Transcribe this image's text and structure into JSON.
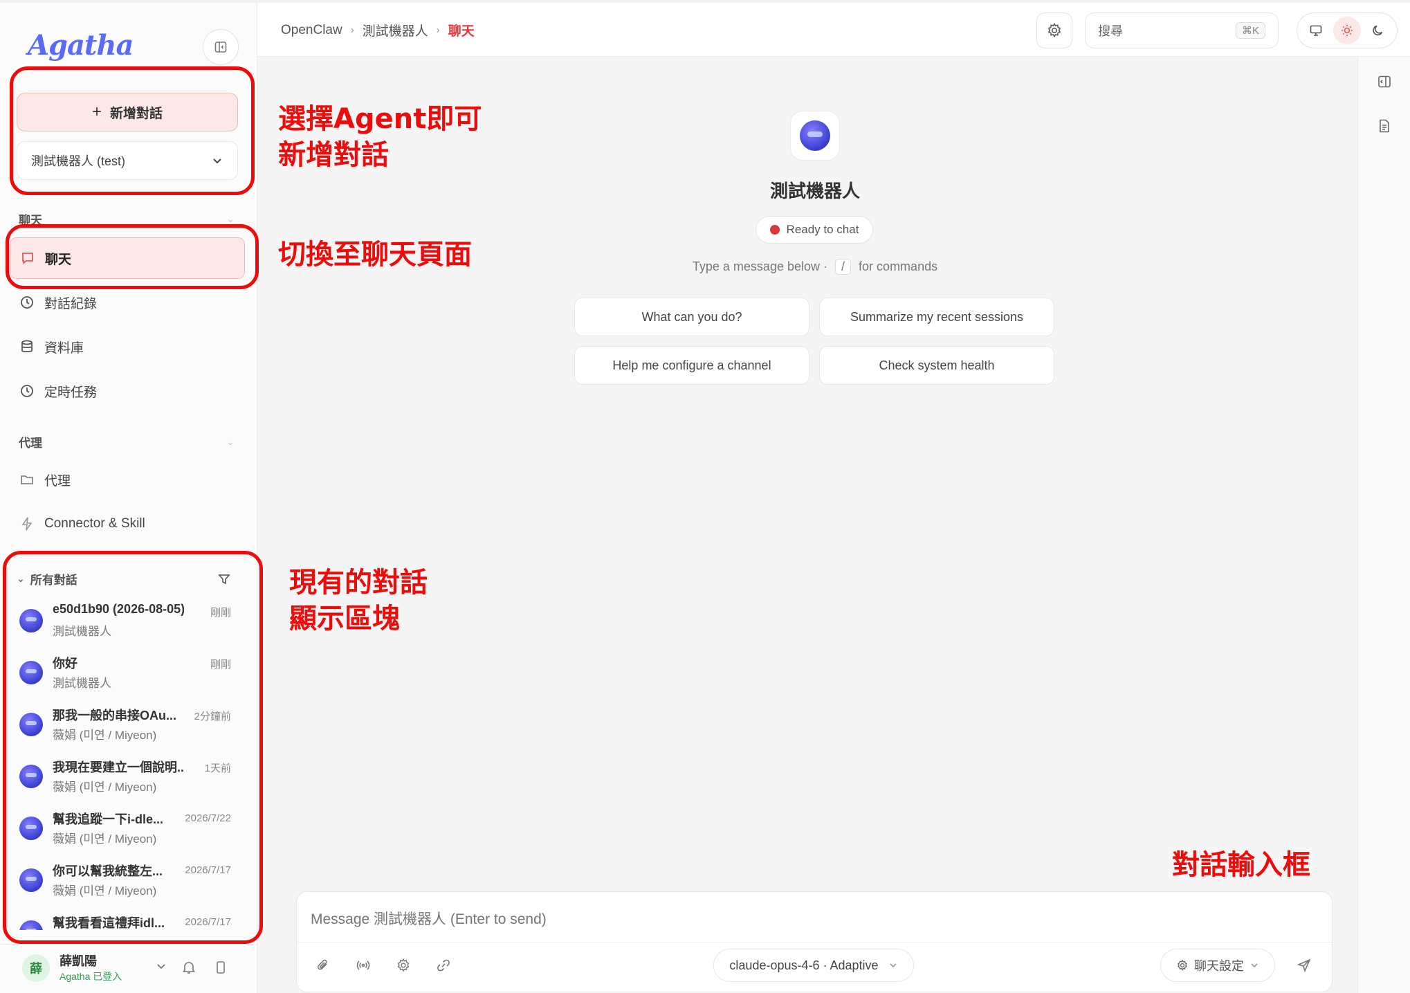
{
  "app": {
    "logo_text": "Agatha",
    "accent_color": "#e23b3b",
    "annotation_color": "#ee0b0b"
  },
  "sidebar": {
    "new_chat_plus": "+",
    "new_chat_label": "新增對話",
    "agent_select_value": "測試機器人 (test)",
    "sections": {
      "chat": "聊天",
      "agents": "代理"
    },
    "nav": [
      {
        "label": "聊天",
        "icon": "chat-bubble-icon"
      },
      {
        "label": "對話紀錄",
        "icon": "history-icon"
      },
      {
        "label": "資料庫",
        "icon": "database-icon"
      },
      {
        "label": "定時任務",
        "icon": "clock-icon"
      }
    ],
    "agent_nav": [
      {
        "label": "代理",
        "icon": "folder-icon"
      },
      {
        "label": "Connector & Skill",
        "icon": "lightning-icon"
      }
    ],
    "conversations_header": "所有對話",
    "conversations": [
      {
        "title": "e50d1b90 (2026-08-05)",
        "time": "剛剛",
        "agent": "測試機器人"
      },
      {
        "title": "你好",
        "time": "剛剛",
        "agent": "測試機器人"
      },
      {
        "title": "那我一般的串接OAu...",
        "time": "2分鐘前",
        "agent": "薇娟 (미연 / Miyeon)"
      },
      {
        "title": "我現在要建立一個說明...",
        "time": "1天前",
        "agent": "薇娟 (미연 / Miyeon)"
      },
      {
        "title": "幫我追蹤一下i-dle...",
        "time": "2026/7/22",
        "agent": "薇娟 (미연 / Miyeon)"
      },
      {
        "title": "你可以幫我統整左...",
        "time": "2026/7/17",
        "agent": "薇娟 (미연 / Miyeon)"
      },
      {
        "title": "幫我看看這禮拜idl...",
        "time": "2026/7/17",
        "agent": ""
      }
    ],
    "user": {
      "avatar_text": "薛",
      "name": "薛凱陽",
      "status": "Agatha 已登入"
    }
  },
  "header": {
    "breadcrumbs": [
      "OpenClaw",
      "測試機器人",
      "聊天"
    ],
    "breadcrumb_sep": "›",
    "search_placeholder": "搜尋",
    "search_shortcut": "⌘K"
  },
  "main": {
    "bot_name": "測試機器人",
    "status": "Ready to chat",
    "hint_before": "Type a message below ·",
    "hint_key": "/",
    "hint_after": "for commands",
    "suggestions": [
      "What can you do?",
      "Summarize my recent sessions",
      "Help me configure a channel",
      "Check system health"
    ]
  },
  "composer": {
    "placeholder": "Message 測試機器人 (Enter to send)",
    "model": "claude-opus-4-6 · Adaptive",
    "settings_label": "聊天設定"
  },
  "annotations": {
    "new_chat": [
      "選擇Agent即可",
      "新增對話"
    ],
    "switch_chat": "切換至聊天頁面",
    "conversations": [
      "現有的對話",
      "顯示區塊"
    ],
    "input": "對話輸入框"
  }
}
